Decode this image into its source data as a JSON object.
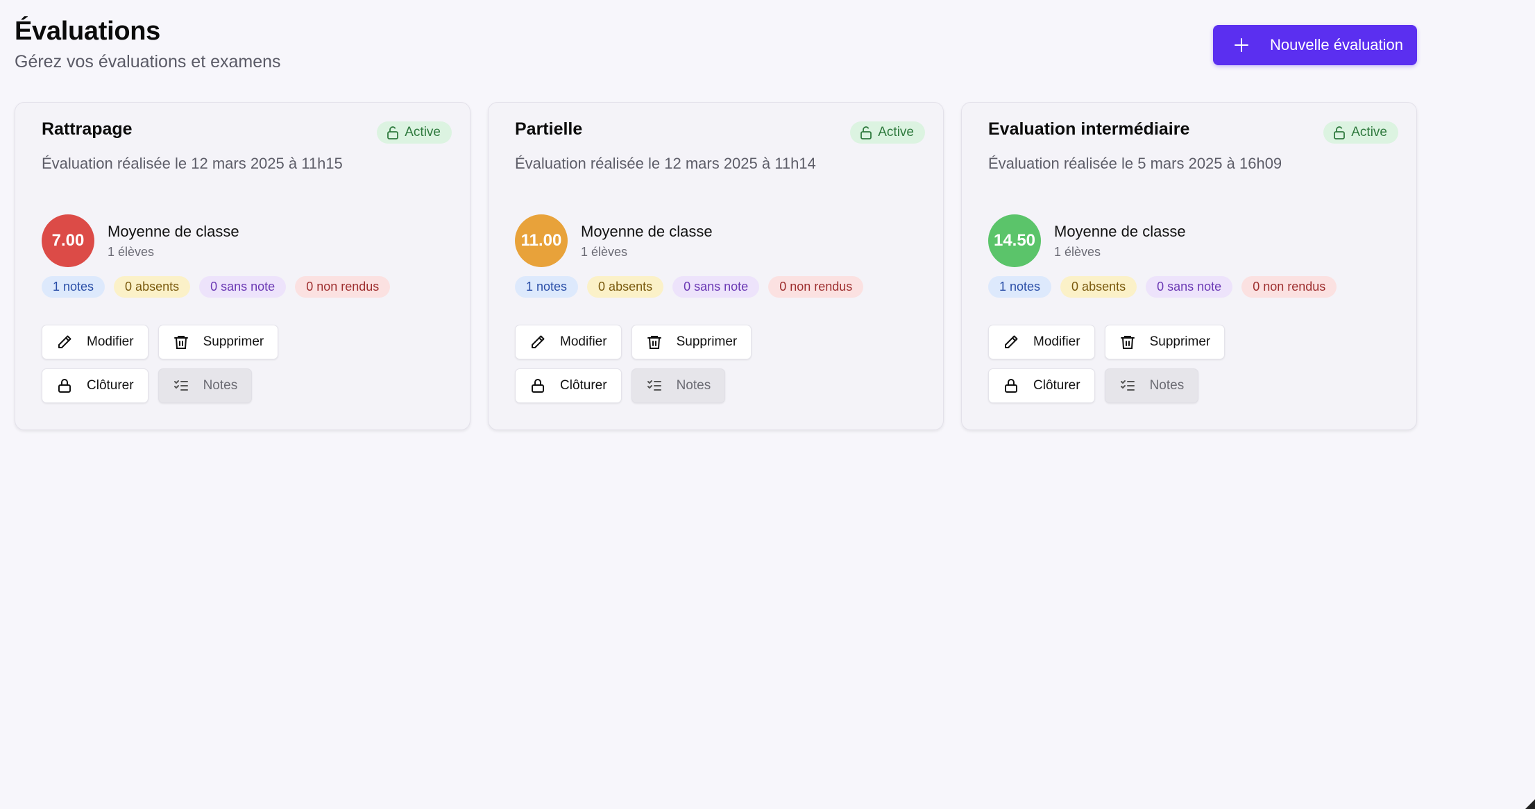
{
  "header": {
    "title": "Évaluations",
    "subtitle": "Gérez vos évaluations et examens",
    "new_button_label": "Nouvelle évaluation"
  },
  "colors": {
    "accent": "#5b2ff0",
    "low": "#dc4b47",
    "medium": "#e8a23a",
    "high": "#5bc46a"
  },
  "cards": [
    {
      "title": "Rattrapage",
      "status": "Active",
      "description": "Évaluation réalisée le 12 mars 2025 à 11h15",
      "average": "7.00",
      "average_color": "#dc4b47",
      "average_label": "Moyenne de classe",
      "students": "1 élèves",
      "stats": {
        "notes": "1 notes",
        "absents": "0 absents",
        "sans_note": "0 sans note",
        "non_rendus": "0 non rendus"
      },
      "buttons": {
        "modifier": "Modifier",
        "supprimer": "Supprimer",
        "cloturer": "Clôturer",
        "notes": "Notes"
      }
    },
    {
      "title": "Partielle",
      "status": "Active",
      "description": "Évaluation réalisée le 12 mars 2025 à 11h14",
      "average": "11.00",
      "average_color": "#e8a23a",
      "average_label": "Moyenne de classe",
      "students": "1 élèves",
      "stats": {
        "notes": "1 notes",
        "absents": "0 absents",
        "sans_note": "0 sans note",
        "non_rendus": "0 non rendus"
      },
      "buttons": {
        "modifier": "Modifier",
        "supprimer": "Supprimer",
        "cloturer": "Clôturer",
        "notes": "Notes"
      }
    },
    {
      "title": "Evaluation intermédiaire",
      "status": "Active",
      "description": "Évaluation réalisée le 5 mars 2025 à 16h09",
      "average": "14.50",
      "average_color": "#5bc46a",
      "average_label": "Moyenne de classe",
      "students": "1 élèves",
      "stats": {
        "notes": "1 notes",
        "absents": "0 absents",
        "sans_note": "0 sans note",
        "non_rendus": "0 non rendus"
      },
      "buttons": {
        "modifier": "Modifier",
        "supprimer": "Supprimer",
        "cloturer": "Clôturer",
        "notes": "Notes"
      }
    }
  ]
}
